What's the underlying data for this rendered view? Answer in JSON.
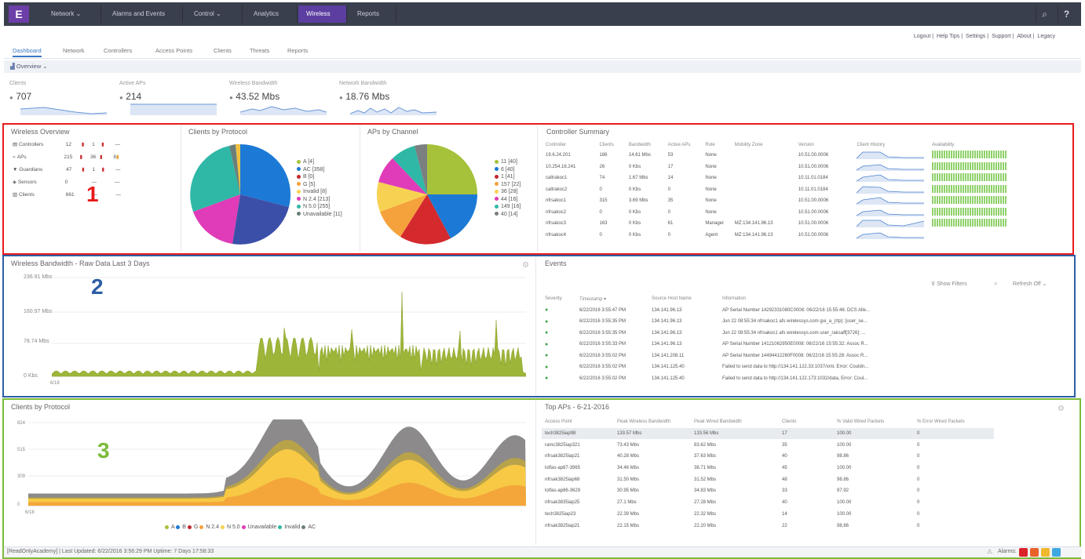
{
  "app": {
    "logo": "E"
  },
  "nav": {
    "items": [
      "Network",
      "Alarms and Events",
      "Control",
      "Analytics",
      "Wireless",
      "Reports"
    ],
    "active": "Wireless",
    "search_icon": "search-icon",
    "help_icon": "help-icon"
  },
  "util_links": [
    "Logout",
    "Help Tips",
    "Settings",
    "Support",
    "About",
    "Legacy"
  ],
  "tabs": [
    "Dashboard",
    "Network",
    "Controllers",
    "Access Points",
    "Clients",
    "Threats",
    "Reports"
  ],
  "active_tab": "Dashboard",
  "overview_button": "Overview",
  "kpis": [
    {
      "label": "Clients",
      "value": "707"
    },
    {
      "label": "Active APs",
      "value": "214"
    },
    {
      "label": "Wireless Bandwidth",
      "value": "43.52 Mbs"
    },
    {
      "label": "Network Bandwidth",
      "value": "18.76 Mbs"
    }
  ],
  "annotations": [
    "1",
    "2",
    "3"
  ],
  "colors": {
    "red_box": "#e81b1b",
    "blue_box": "#2c5ea5",
    "green_box": "#7bbb3a",
    "nav_bg": "#3a3f4d",
    "accent": "#5b3ea0"
  },
  "wireless_overview": {
    "title": "Wireless Overview",
    "rows": [
      {
        "label": "Controllers",
        "count": "12",
        "a": "1",
        "b": "—"
      },
      {
        "label": "APs",
        "count": "215",
        "a": "36",
        "b": "8"
      },
      {
        "label": "Guardians",
        "count": "47",
        "a": "1",
        "b": "—"
      },
      {
        "label": "Sensors",
        "count": "0",
        "a": "—",
        "b": "—"
      },
      {
        "label": "Clients",
        "count": "661",
        "a": "—",
        "b": "—"
      }
    ]
  },
  "clients_by_protocol_pie": {
    "title": "Clients by Protocol",
    "legend": [
      "A [4]",
      "AC [358]",
      "B [0]",
      "G [5]",
      "Invalid [8]",
      "N 2.4 [213]",
      "N 5.0 [255]",
      "Unavailable [11]"
    ]
  },
  "aps_by_channel": {
    "title": "APs by Channel",
    "legend": [
      "11 [40]",
      "6 [40]",
      "1 [41]",
      "157 [22]",
      "36 [28]",
      "44 [16]",
      "149 [16]",
      "40 [14]"
    ]
  },
  "controller_summary": {
    "title": "Controller Summary",
    "columns": [
      "Controller",
      "Clients",
      "Bandwidth",
      "Active APs",
      "Role",
      "Mobility Zone",
      "Version",
      "Client History",
      "Availability"
    ],
    "rows": [
      [
        "19.6.24.201",
        "186",
        "14.61 Mbs",
        "53",
        "None",
        "",
        "10.51.00.0006",
        "",
        ""
      ],
      [
        "10.254.16.241",
        "26",
        "0 Kbs",
        "17",
        "None",
        "",
        "10.51.00.0006",
        "",
        ""
      ],
      [
        "caltrakoc1",
        "74",
        "1.67 Mbs",
        "14",
        "None",
        "",
        "10.11.01.0184",
        "",
        ""
      ],
      [
        "caltrakoc2",
        "0",
        "0 Kbs",
        "0",
        "None",
        "",
        "10.11.01.0184",
        "",
        ""
      ],
      [
        "nfrsakoc1",
        "315",
        "3.69 Mbs",
        "35",
        "None",
        "",
        "10.51.00.0006",
        "",
        ""
      ],
      [
        "nfrsakoc2",
        "0",
        "0 Kbs",
        "0",
        "None",
        "",
        "10.51.00.0006",
        "",
        ""
      ],
      [
        "nfrsakoc3",
        "163",
        "0 Kbs",
        "61",
        "Manager",
        "MZ:134.141.96.13",
        "10.51.00.0006",
        "",
        ""
      ],
      [
        "nfrsakoc4",
        "0",
        "0 Kbs",
        "0",
        "Agent",
        "MZ:134.141.96.13",
        "10.51.00.0006",
        "",
        ""
      ]
    ]
  },
  "bandwidth_chart": {
    "title": "Wireless Bandwidth - Raw Data Last 3 Days",
    "y_ticks": [
      "236.91 Mbs",
      "160.97 Mbs",
      "78.74 Mbs",
      "0 Kbs"
    ],
    "x_ticks": [
      "6/18"
    ]
  },
  "events": {
    "title": "Events",
    "show_filters": "Show Filters",
    "refresh": "Refresh Off",
    "columns": [
      "Severity",
      "Timestamp",
      "Source Host Name",
      "Information"
    ],
    "rows": [
      [
        "6/22/2016 3:55:47 PM",
        "134.141.96.13",
        "AP Serial Number 14292331080C0008: 06/22/16 15:55:46: DCS Alle..."
      ],
      [
        "6/22/2016 3:55:35 PM",
        "134.141.96.13",
        "Jun 22 08:55:34 nfrsakoc1 afs wirelessys.com gui_a_(rtp): [user_se..."
      ],
      [
        "6/22/2016 3:55:35 PM",
        "134.141.96.13",
        "Jun 22 08:55:34 nfrsakoc1 afs wirelessys.com user_raksaff[3726]: ..."
      ],
      [
        "6/22/2016 3:55:33 PM",
        "134.141.96.13",
        "AP Serial Number 14121062950E0008: 06/22/16 15:55:32: Assoc R..."
      ],
      [
        "6/22/2016 3:55:02 PM",
        "134.141.208.11",
        "AP Serial Number 14494412260F0008: 06/22/16 15:55:28: Assoc R..."
      ],
      [
        "6/22/2016 3:55:02 PM",
        "134.141.125.40",
        "Failed to send data to http://134.141.122.33:1037/xml, Error: Couldn..."
      ],
      [
        "6/22/2016 3:55:02 PM",
        "134.141.125.40",
        "Failed to send data to http://134.141.122.173:1032/data, Error: Coul..."
      ]
    ]
  },
  "clients_area_chart": {
    "title": "Clients by Protocol",
    "y_ticks": [
      "824",
      "515",
      "309",
      "0"
    ],
    "x_ticks": [
      "6/18"
    ],
    "legend": [
      "A",
      "B",
      "G",
      "N 2.4",
      "N 5.0",
      "Unavailable",
      "Invalid",
      "AC"
    ]
  },
  "top_aps": {
    "title": "Top APs - 6-21-2016",
    "columns": [
      "Access Point",
      "Peak Wireless Bandwidth",
      "Peak Wired Bandwidth",
      "Clients",
      "% Valid Wired Packets",
      "% Error Wired Packets"
    ],
    "rows": [
      [
        "tech3825iap98",
        "133.57 Mbs",
        "133.56 Mbs",
        "17",
        "100.00",
        "0"
      ],
      [
        "ramc3825iap321",
        "73.43 Mbs",
        "83.62 Mbs",
        "35",
        "100.00",
        "0"
      ],
      [
        "nfrsak3825iap21",
        "40.28 Mbs",
        "37.63 Mbs",
        "40",
        "98.86",
        "0"
      ],
      [
        "lotfas-ap87-3965",
        "34.46 Mbs",
        "38.71 Mbs",
        "45",
        "100.00",
        "0"
      ],
      [
        "nfrsak3825iap68",
        "31.50 Mbs",
        "31.52 Mbs",
        "48",
        "98.86",
        "0"
      ],
      [
        "lotfas-ap86-3629",
        "30.95 Mbs",
        "34.83 Mbs",
        "33",
        "97.92",
        "0"
      ],
      [
        "nfrsak3835iap25",
        "27.1 Mbs",
        "27.28 Mbs",
        "40",
        "100.00",
        "0"
      ],
      [
        "tech3825iap23",
        "22.39 Mbs",
        "22.32 Mbs",
        "14",
        "100.00",
        "0"
      ],
      [
        "nfrsak3825iap21",
        "22.15 Mbs",
        "22.20 Mbs",
        "22",
        "98.86",
        "0"
      ]
    ]
  },
  "status": {
    "text": "[ReadOnlyAcademy] | Last Updated: 6/22/2016 3:56:29 PM  Uptime: 7 Days 17:58:33",
    "alarms_label": "Alarms:"
  }
}
